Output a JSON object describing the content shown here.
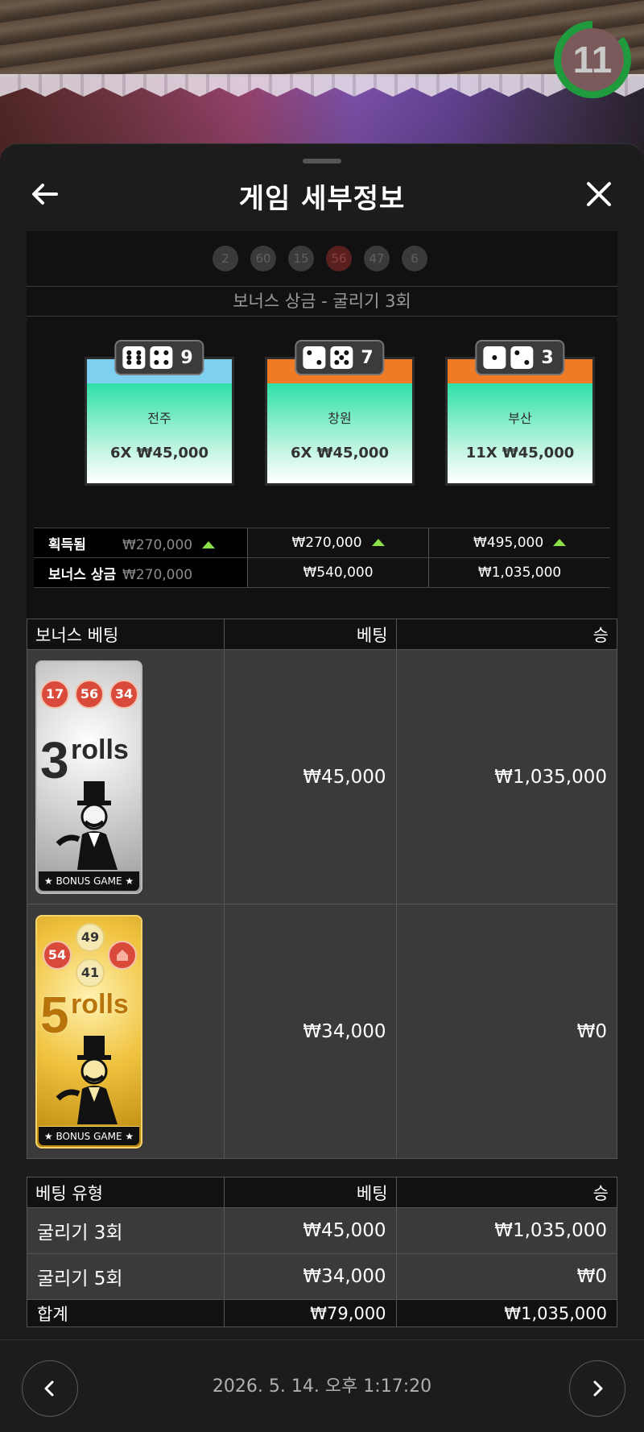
{
  "timer": {
    "seconds": "11"
  },
  "header": {
    "title": "게임 세부정보",
    "back_icon": "arrow-left-icon",
    "close_icon": "close-icon"
  },
  "ball_history": [
    "2",
    "60",
    "15",
    "56",
    "47",
    "6"
  ],
  "section_title": "보너스 상금 - 굴리기 3회",
  "cards": [
    {
      "dice": "9",
      "city": "전주",
      "multiplier": "6X ₩45,000",
      "color": "#7fd0f0"
    },
    {
      "dice": "7",
      "city": "창원",
      "multiplier": "6X ₩45,000",
      "color": "#f07a25"
    },
    {
      "dice": "3",
      "city": "부산",
      "multiplier": "11X ₩45,000",
      "color": "#f07a25"
    }
  ],
  "win_table": {
    "row1_label": "획득됨",
    "row2_label": "보너스 상금",
    "row1": [
      "₩270,000",
      "₩270,000",
      "₩495,000"
    ],
    "row2": [
      "₩270,000",
      "₩540,000",
      "₩1,035,000"
    ]
  },
  "bonus_table": {
    "headers": [
      "보너스 베팅",
      "베팅",
      "승"
    ],
    "rows": [
      {
        "balls": [
          "17",
          "56",
          "34"
        ],
        "rolls_num": "3",
        "rolls_text": "rolls",
        "footer": "★ BONUS GAME ★",
        "bet": "₩45,000",
        "win": "₩1,035,000"
      },
      {
        "balls": [
          "49",
          "54",
          "41"
        ],
        "rolls_num": "5",
        "rolls_text": "rolls",
        "footer": "★ BONUS GAME ★",
        "bet": "₩34,000",
        "win": "₩0"
      }
    ]
  },
  "type_table": {
    "headers": [
      "베팅 유형",
      "베팅",
      "승"
    ],
    "rows": [
      {
        "type": "굴리기 3회",
        "bet": "₩45,000",
        "win": "₩1,035,000"
      },
      {
        "type": "굴리기 5회",
        "bet": "₩34,000",
        "win": "₩0"
      }
    ],
    "total": {
      "type": "합계",
      "bet": "₩79,000",
      "win": "₩1,035,000"
    }
  },
  "footer": {
    "date": "2026. 5. 14. 오후 1:17:20",
    "prev_icon": "chevron-left-icon",
    "next_icon": "chevron-right-icon"
  }
}
